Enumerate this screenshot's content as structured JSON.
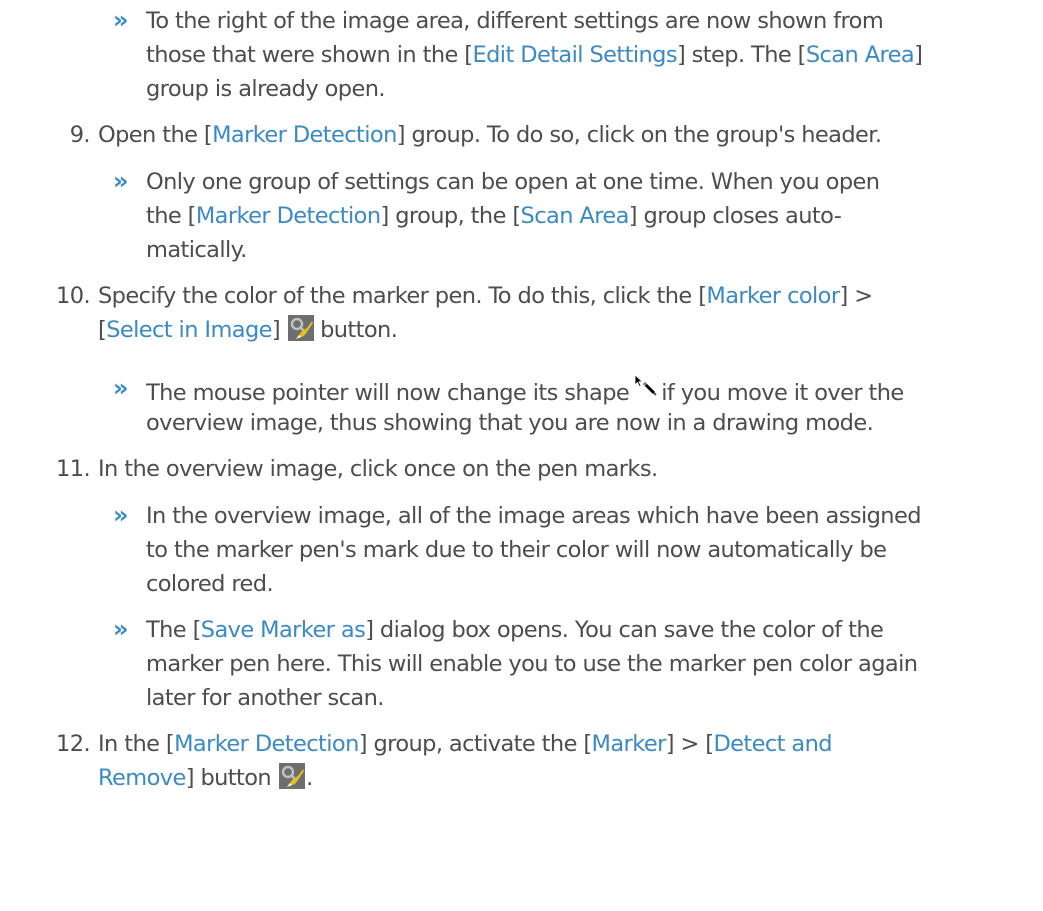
{
  "marker_glyph": "»",
  "colors": {
    "text": "#4d4d4d",
    "link": "#3b8ac4"
  },
  "r1": {
    "l1": "To the right of the image area, different settings are now shown from",
    "l2a": "those that were shown in the [",
    "l2b": "Edit Detail Settings",
    "l2c": "] step. The [",
    "l2d": "Scan Area",
    "l2e": "]",
    "l3": "group is already open."
  },
  "s9": {
    "num": "9.",
    "a": "Open the [",
    "b": "Marker Detection",
    "c": "] group. To do so, click on the group's header."
  },
  "r2": {
    "l1": "Only one group of settings can be open at one time. When you open",
    "l2a": "the [",
    "l2b": "Marker Detection",
    "l2c": "] group, the [",
    "l2d": "Scan Area",
    "l2e": "] group closes auto-",
    "l3": "matically."
  },
  "s10": {
    "num": "10.",
    "l1a": "Specify the color of the marker pen. To do this, click the [",
    "l1b": "Marker color",
    "l1c": "] >",
    "l2a": "[",
    "l2b": "Select in Image",
    "l2c": "]",
    "l2d": "button.",
    "icon": "eyedropper-icon"
  },
  "r3": {
    "l1a": "The mouse pointer will now change its shape",
    "l1b": "if you move it over the",
    "l2": "overview image, thus showing that you are now in a drawing mode.",
    "icon": "pen-cursor-icon"
  },
  "s11": {
    "num": "11.",
    "text": "In the overview image, click once on the pen marks."
  },
  "r4": {
    "l1": "In the overview image, all of the image areas which have been assigned",
    "l2": "to the marker pen's mark due to their color will now automatically be",
    "l3": "colored red."
  },
  "r5": {
    "l1a": "The [",
    "l1b": "Save Marker as",
    "l1c": "] dialog box opens. You can save the color of the",
    "l2": "marker pen here. This will enable you to use the marker pen color again",
    "l3": "later for another scan."
  },
  "s12": {
    "num": "12.",
    "l1a": "In the [",
    "l1b": "Marker Detection",
    "l1c": "] group, activate the [",
    "l1d": "Marker",
    "l1e": "] > [",
    "l1f": "Detect and",
    "l2a": "Remove",
    "l2b": "] button",
    "l2c": ".",
    "icon": "eyedropper-icon"
  }
}
